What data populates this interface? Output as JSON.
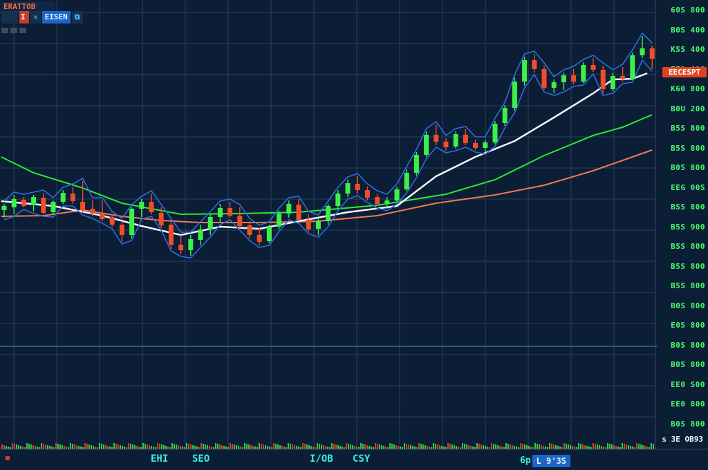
{
  "header": {
    "symbol": "ERATTOB",
    "badge_red": "I",
    "badge_dark": "✕",
    "badge_blue": "EISEN",
    "badge_icon": "⧉"
  },
  "price_tag": "EECESPT",
  "last_tag": "s 3E OB93",
  "bottom_badge": {
    "text": "6p",
    "value": "L 9'3S"
  },
  "colors": {
    "background": "#0c1e35",
    "grid": "#27405e",
    "up": "#3cf04a",
    "down": "#ef4e2a",
    "ma_white": "#f2f4f7",
    "ma_green": "#2fe53a",
    "ma_salmon": "#f07a52",
    "ma_blue": "#2a6fe0"
  },
  "chart_data": {
    "type": "candlestick",
    "y_axis_labels": [
      "60S 800",
      "B0S 400",
      "KSS 400",
      "EE0 400",
      "K60 800",
      "B0U 200",
      "B5S 800",
      "B5S 800",
      "B05 800",
      "EEG 00S",
      "BSS 800",
      "B5S 900",
      "BSS 800",
      "B5S 800",
      "B5S 800",
      "B0S 800",
      "E0S 800",
      "B0S 800",
      "B0S 800",
      "EE0 S00",
      "EE0 800",
      "B0S 800"
    ],
    "x_axis_labels": [
      "EHI",
      "SEO",
      "I/OB",
      "CSY"
    ],
    "candles": [
      [
        0.0,
        56.6,
        57.5,
        55.5,
        57.2
      ],
      [
        1.0,
        57.0,
        58.8,
        56.0,
        58.2
      ],
      [
        2.0,
        58.1,
        58.5,
        57.0,
        57.2
      ],
      [
        3.0,
        57.3,
        58.8,
        56.4,
        58.5
      ],
      [
        4.0,
        58.4,
        59.1,
        56.0,
        56.2
      ],
      [
        5.0,
        56.3,
        58.0,
        55.9,
        57.8
      ],
      [
        6.0,
        57.8,
        59.5,
        57.5,
        59.1
      ],
      [
        7.0,
        59.0,
        60.0,
        57.5,
        57.9
      ],
      [
        8.0,
        57.8,
        60.8,
        56.2,
        56.6
      ],
      [
        9.0,
        56.8,
        58.0,
        55.7,
        56.1
      ],
      [
        10.0,
        56.0,
        58.0,
        55.0,
        55.3
      ],
      [
        11.0,
        55.6,
        56.0,
        54.2,
        54.5
      ],
      [
        12.0,
        54.5,
        55.0,
        52.0,
        53.0
      ],
      [
        13.0,
        53.0,
        57.0,
        52.5,
        56.8
      ],
      [
        14.0,
        56.8,
        58.2,
        55.6,
        57.8
      ],
      [
        15.0,
        57.8,
        59.0,
        56.0,
        56.3
      ],
      [
        16.0,
        56.2,
        57.0,
        54.0,
        54.4
      ],
      [
        17.0,
        54.5,
        55.0,
        51.0,
        51.6
      ],
      [
        18.0,
        51.6,
        53.0,
        50.2,
        50.8
      ],
      [
        19.0,
        50.8,
        53.0,
        50.0,
        52.4
      ],
      [
        20.0,
        52.3,
        54.5,
        51.5,
        53.8
      ],
      [
        21.0,
        53.8,
        56.0,
        53.0,
        55.6
      ],
      [
        22.0,
        55.6,
        57.5,
        54.8,
        56.9
      ],
      [
        23.0,
        56.9,
        57.8,
        55.5,
        55.8
      ],
      [
        24.0,
        55.8,
        57.0,
        54.0,
        54.3
      ],
      [
        25.0,
        54.4,
        55.0,
        52.5,
        53.0
      ],
      [
        26.0,
        53.0,
        54.0,
        51.5,
        52.0
      ],
      [
        27.0,
        52.1,
        54.5,
        51.8,
        54.2
      ],
      [
        28.0,
        54.2,
        56.5,
        53.8,
        56.1
      ],
      [
        29.0,
        56.1,
        58.0,
        55.5,
        57.5
      ],
      [
        30.0,
        57.4,
        58.2,
        55.0,
        55.2
      ],
      [
        31.0,
        55.2,
        56.0,
        53.5,
        53.8
      ],
      [
        32.0,
        53.9,
        55.5,
        53.0,
        55.0
      ],
      [
        33.0,
        55.0,
        57.5,
        54.5,
        57.2
      ],
      [
        34.0,
        57.2,
        59.5,
        56.8,
        59.0
      ],
      [
        35.0,
        59.0,
        61.0,
        58.5,
        60.5
      ],
      [
        36.0,
        60.4,
        61.5,
        59.0,
        59.5
      ],
      [
        37.0,
        59.5,
        60.0,
        58.0,
        58.4
      ],
      [
        38.0,
        58.5,
        59.0,
        57.2,
        57.5
      ],
      [
        39.0,
        57.6,
        58.5,
        56.8,
        58.0
      ],
      [
        40.0,
        58.0,
        60.0,
        57.8,
        59.6
      ],
      [
        41.0,
        59.6,
        62.5,
        59.4,
        62.0
      ],
      [
        42.0,
        62.0,
        65.0,
        61.6,
        64.6
      ],
      [
        43.0,
        64.6,
        68.0,
        64.3,
        67.5
      ],
      [
        44.0,
        67.5,
        69.0,
        66.0,
        66.5
      ],
      [
        45.0,
        66.5,
        67.0,
        65.2,
        65.7
      ],
      [
        46.0,
        65.8,
        68.0,
        65.5,
        67.6
      ],
      [
        47.0,
        67.5,
        68.3,
        66.0,
        66.3
      ],
      [
        48.0,
        66.3,
        66.8,
        65.3,
        65.6
      ],
      [
        49.0,
        65.6,
        66.8,
        65.0,
        66.4
      ],
      [
        50.0,
        66.4,
        69.5,
        66.1,
        69.1
      ],
      [
        51.0,
        69.2,
        71.8,
        68.8,
        71.4
      ],
      [
        52.0,
        71.4,
        75.8,
        71.0,
        75.2
      ],
      [
        53.0,
        75.2,
        78.8,
        74.6,
        78.3
      ],
      [
        54.0,
        78.3,
        79.2,
        76.5,
        77.0
      ],
      [
        55.0,
        77.0,
        77.5,
        74.0,
        74.3
      ],
      [
        56.0,
        74.3,
        75.5,
        73.5,
        75.1
      ],
      [
        57.0,
        75.1,
        76.5,
        74.0,
        76.1
      ],
      [
        58.0,
        76.1,
        77.0,
        74.8,
        75.2
      ],
      [
        59.0,
        75.2,
        78.0,
        75.0,
        77.6
      ],
      [
        60.0,
        77.6,
        78.6,
        76.6,
        76.9
      ],
      [
        61.0,
        76.9,
        77.5,
        73.5,
        74.1
      ],
      [
        62.0,
        74.1,
        76.5,
        73.8,
        76.0
      ],
      [
        63.0,
        76.0,
        77.3,
        75.2,
        75.6
      ],
      [
        64.0,
        75.6,
        79.4,
        75.4,
        79.0
      ],
      [
        65.0,
        79.0,
        81.8,
        78.6,
        80.0
      ],
      [
        66.0,
        80.0,
        80.4,
        77.0,
        78.5
      ]
    ],
    "ma_white": [
      [
        -0.3,
        57.9
      ],
      [
        5.0,
        57.2
      ],
      [
        10.0,
        55.8
      ],
      [
        14.0,
        54.3
      ],
      [
        18.0,
        53.0
      ],
      [
        22.0,
        54.2
      ],
      [
        26.0,
        53.9
      ],
      [
        30.0,
        55.0
      ],
      [
        35.0,
        56.3
      ],
      [
        40.0,
        57.2
      ],
      [
        44.0,
        61.5
      ],
      [
        48.0,
        64.3
      ],
      [
        52.0,
        66.6
      ],
      [
        56.0,
        70.0
      ],
      [
        60.0,
        73.5
      ],
      [
        62.0,
        75.5
      ],
      [
        64.0,
        75.6
      ],
      [
        65.5,
        76.4
      ]
    ],
    "ma_green": [
      [
        -0.3,
        64.3
      ],
      [
        3.0,
        62.0
      ],
      [
        8.0,
        59.8
      ],
      [
        12.0,
        57.6
      ],
      [
        18.0,
        56.0
      ],
      [
        24.0,
        56.1
      ],
      [
        30.0,
        56.3
      ],
      [
        38.0,
        57.3
      ],
      [
        45.0,
        58.9
      ],
      [
        50.0,
        61.0
      ],
      [
        55.0,
        64.5
      ],
      [
        60.0,
        67.4
      ],
      [
        63.0,
        68.6
      ],
      [
        66.0,
        70.4
      ]
    ],
    "ma_salmon": [
      [
        -0.3,
        55.7
      ],
      [
        4.0,
        55.8
      ],
      [
        8.0,
        56.6
      ],
      [
        12.0,
        55.7
      ],
      [
        16.0,
        55.1
      ],
      [
        20.0,
        54.8
      ],
      [
        26.0,
        54.8
      ],
      [
        32.0,
        55.0
      ],
      [
        38.0,
        55.8
      ],
      [
        44.0,
        57.6
      ],
      [
        50.0,
        58.8
      ],
      [
        55.0,
        60.2
      ],
      [
        60.0,
        62.3
      ],
      [
        64.0,
        64.3
      ],
      [
        66.0,
        65.3
      ]
    ]
  }
}
